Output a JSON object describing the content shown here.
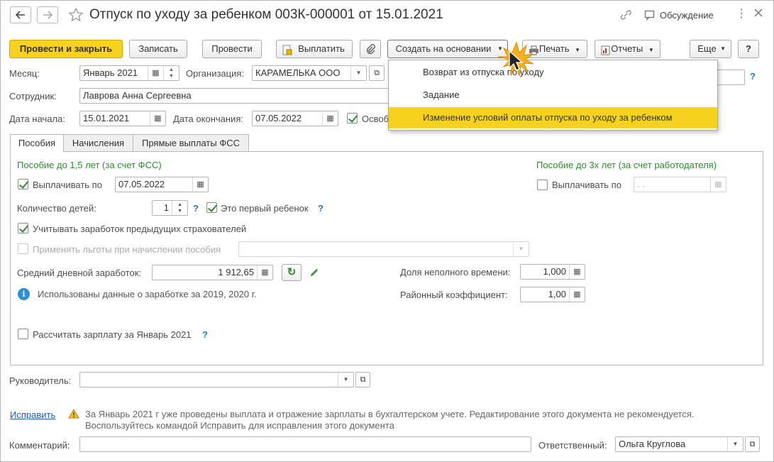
{
  "window": {
    "title": "Отпуск по уходу за ребенком 003К-000001 от 15.01.2021",
    "discussion_label": "Обсуждение"
  },
  "toolbar": {
    "post_close": "Провести и закрыть",
    "save": "Записать",
    "post": "Провести",
    "pay": "Выплатить",
    "create_based": "Создать на основании",
    "print": "Печать",
    "reports": "Отчеты",
    "more": "Еще",
    "help": "?"
  },
  "dropdown": {
    "items": [
      "Возврат из отпуска по уходу",
      "Задание",
      "Изменение условий оплаты отпуска по уходу за ребенком"
    ],
    "highlighted_index": 2
  },
  "header": {
    "month_label": "Месяц:",
    "month_value": "Январь 2021",
    "org_label": "Организация:",
    "org_value": "КАРАМЕЛЬКА ООО",
    "employee_label": "Сотрудник:",
    "employee_value": "Лаврова Анна Сергеевна",
    "start_label": "Дата начала:",
    "start_value": "15.01.2021",
    "end_label": "Дата окончания:",
    "end_value": "07.05.2022",
    "release_label": "Освоб",
    "release_checked": true
  },
  "tabs": [
    "Пособия",
    "Начисления",
    "Прямые выплаты ФСС"
  ],
  "benefits": {
    "section_left": "Пособие до 1,5 лет (за счет ФСС)",
    "section_right": "Пособие до 3х лет (за счет работодателя)",
    "pay_until_label": "Выплачивать по",
    "pay_until_value": "07.05.2022",
    "pay_until_checked": true,
    "pay_until3_label": "Выплачивать по",
    "pay_until3_value": " .  .",
    "pay_until3_checked": false,
    "children_label": "Количество детей:",
    "children_value": "1",
    "first_child_label": "Это первый ребенок",
    "first_child_checked": true,
    "prev_insurers_label": "Учитывать заработок предыдущих страхователей",
    "prev_insurers_checked": true,
    "privileges_label": "Применять льготы при начислении пособия",
    "privileges_checked": false,
    "avg_label": "Средний дневной заработок:",
    "avg_value": "1 912,65",
    "part_time_label": "Доля неполного времени:",
    "part_time_value": "1,000",
    "regional_label": "Районный коэффициент:",
    "regional_value": "1,00",
    "info_text": "Использованы данные о заработке за  2019,  2020 г.",
    "calc_label": "Рассчитать зарплату за Январь 2021",
    "calc_checked": false,
    "help_mark": "?"
  },
  "footer": {
    "manager_label": "Руководитель:",
    "manager_value": "",
    "fix_link": "Исправить",
    "warning_line1": "За Январь 2021 г уже проведены выплата и отражение зарплаты в бухгалтерском учете. Редактирование этого документа не рекомендуется.",
    "warning_line2": "Воспользуйтесь командой Исправить для исправления этого документа",
    "comment_label": "Комментарий:",
    "comment_value": "",
    "responsible_label": "Ответственный:",
    "responsible_value": "Ольга Круглова"
  },
  "colors": {
    "accent_yellow": "#f6d21f",
    "section_green": "#2e8b2e",
    "link_blue": "#1d5bb6",
    "help_blue": "#1d7ac9"
  }
}
